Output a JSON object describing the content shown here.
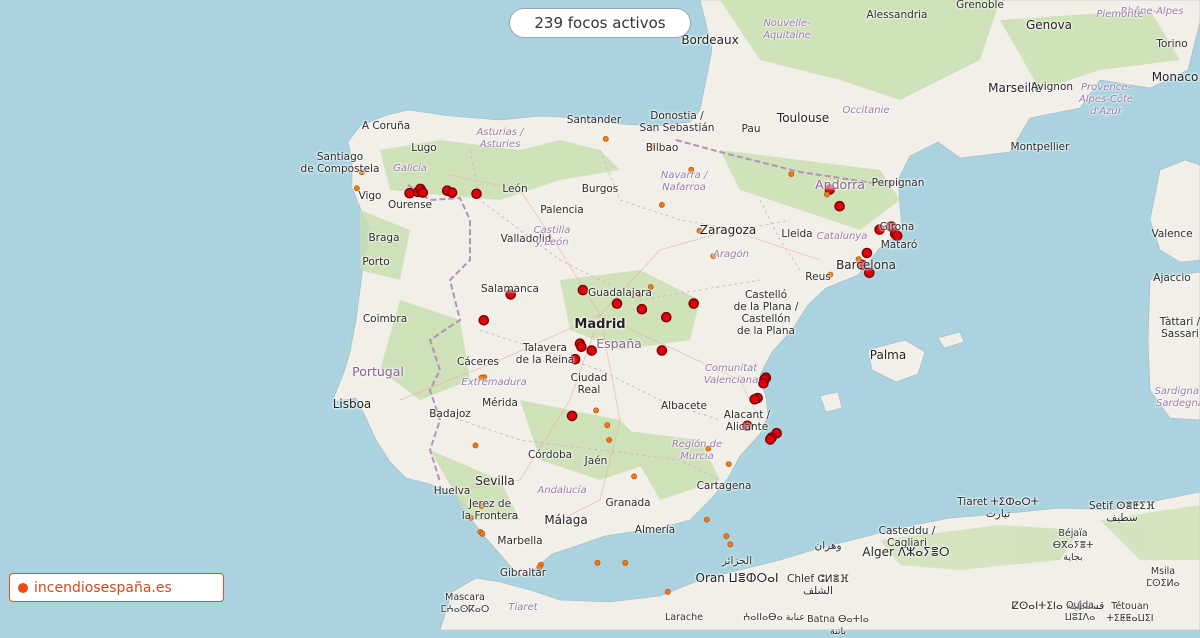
{
  "counter": {
    "text": "239 focos activos"
  },
  "brand": {
    "text": "incendiosespaña.es",
    "color": "#ef4a11"
  },
  "colors": {
    "sea": "#aad3df",
    "land": "#f2efe9",
    "forest": "#c9dfb1",
    "fire_large": "#e0000b",
    "fire_small": "#f07a16",
    "border": "#b292b8"
  },
  "labels": [
    {
      "text": "A Coruña",
      "kind": "city"
    },
    {
      "text": "Lugo",
      "kind": "city"
    },
    {
      "text": "Santiago\nde Compostela",
      "kind": "city"
    },
    {
      "text": "Galicia",
      "kind": "region"
    },
    {
      "text": "Vigo",
      "kind": "city"
    },
    {
      "text": "Ourense",
      "kind": "city"
    },
    {
      "text": "Braga",
      "kind": "city"
    },
    {
      "text": "Porto",
      "kind": "city"
    },
    {
      "text": "Coimbra",
      "kind": "city"
    },
    {
      "text": "Portugal",
      "kind": "country"
    },
    {
      "text": "Lisboa",
      "kind": "bigcity"
    },
    {
      "text": "Asturias /\nAsturies",
      "kind": "region"
    },
    {
      "text": "León",
      "kind": "city"
    },
    {
      "text": "Santander",
      "kind": "city"
    },
    {
      "text": "Bilbao",
      "kind": "city"
    },
    {
      "text": "Donostia /\nSan Sebastián",
      "kind": "city"
    },
    {
      "text": "Burgos",
      "kind": "city"
    },
    {
      "text": "Palencia",
      "kind": "city"
    },
    {
      "text": "Valladolid",
      "kind": "city"
    },
    {
      "text": "Castilla\ny León",
      "kind": "region"
    },
    {
      "text": "Navarra /\nNafarroa",
      "kind": "region"
    },
    {
      "text": "Zaragoza",
      "kind": "bigcity"
    },
    {
      "text": "Aragón",
      "kind": "region"
    },
    {
      "text": "Salamanca",
      "kind": "city"
    },
    {
      "text": "Guadalajara",
      "kind": "city"
    },
    {
      "text": "Madrid",
      "kind": "capital"
    },
    {
      "text": "España",
      "kind": "country"
    },
    {
      "text": "Talavera\nde la Reina",
      "kind": "city"
    },
    {
      "text": "Cáceres",
      "kind": "city"
    },
    {
      "text": "Extremadura",
      "kind": "region"
    },
    {
      "text": "Mérida",
      "kind": "city"
    },
    {
      "text": "Badajoz",
      "kind": "city"
    },
    {
      "text": "Ciudad\nReal",
      "kind": "city"
    },
    {
      "text": "Albacete",
      "kind": "city"
    },
    {
      "text": "Córdoba",
      "kind": "city"
    },
    {
      "text": "Jaén",
      "kind": "city"
    },
    {
      "text": "Sevilla",
      "kind": "bigcity"
    },
    {
      "text": "Andalucía",
      "kind": "region"
    },
    {
      "text": "Huelva",
      "kind": "city"
    },
    {
      "text": "Jerez de\nla Frontera",
      "kind": "city"
    },
    {
      "text": "Granada",
      "kind": "city"
    },
    {
      "text": "Málaga",
      "kind": "bigcity"
    },
    {
      "text": "Almería",
      "kind": "city"
    },
    {
      "text": "Marbella",
      "kind": "city"
    },
    {
      "text": "Gibraltar",
      "kind": "city"
    },
    {
      "text": "Región de\nMurcia",
      "kind": "region"
    },
    {
      "text": "Cartagena",
      "kind": "city"
    },
    {
      "text": "Alacant /\nAlicante",
      "kind": "city"
    },
    {
      "text": "Comunitat\nValenciana",
      "kind": "region"
    },
    {
      "text": "Castelló\nde la Plana /\nCastellón\nde la Plana",
      "kind": "city"
    },
    {
      "text": "Lleida",
      "kind": "city"
    },
    {
      "text": "Catalunya",
      "kind": "region"
    },
    {
      "text": "Reus",
      "kind": "city"
    },
    {
      "text": "Barcelona",
      "kind": "bigcity"
    },
    {
      "text": "Mataró",
      "kind": "city"
    },
    {
      "text": "Girona",
      "kind": "city"
    },
    {
      "text": "Andorra",
      "kind": "country"
    },
    {
      "text": "Perpignan",
      "kind": "city"
    },
    {
      "text": "Palma",
      "kind": "bigcity"
    },
    {
      "text": "Bordeaux",
      "kind": "bigcity"
    },
    {
      "text": "Nouvelle-\nAquitaine",
      "kind": "region"
    },
    {
      "text": "Pau",
      "kind": "city"
    },
    {
      "text": "Toulouse",
      "kind": "bigcity"
    },
    {
      "text": "Occitanie",
      "kind": "region"
    },
    {
      "text": "Montpellier",
      "kind": "city"
    },
    {
      "text": "Marseille",
      "kind": "bigcity"
    },
    {
      "text": "Avignon",
      "kind": "city"
    },
    {
      "text": "Provence-\nAlpes-Côte\nd'Azur",
      "kind": "region"
    },
    {
      "text": "Monaco",
      "kind": "bigcity"
    },
    {
      "text": "Genova",
      "kind": "bigcity"
    },
    {
      "text": "Grenoble",
      "kind": "city"
    },
    {
      "text": "Rhône-Alpes",
      "kind": "region"
    },
    {
      "text": "Piemonte",
      "kind": "region"
    },
    {
      "text": "Torino",
      "kind": "city"
    },
    {
      "text": "Alessandria",
      "kind": "city"
    },
    {
      "text": "Valence",
      "kind": "city"
    },
    {
      "text": "Ajaccio",
      "kind": "city"
    },
    {
      "text": "Tàttari /\nSassari",
      "kind": "city"
    },
    {
      "text": "Sardigna /\nSardegna",
      "kind": "region"
    },
    {
      "text": "Casteddu /\nCagliari",
      "kind": "city"
    },
    {
      "text": "Alger ⴷⵣⴰⵢⴻⵔ",
      "kind": "bigcity"
    },
    {
      "text": "الجزائر",
      "kind": "city"
    },
    {
      "text": "Oran ⵡⴻⵀⵔⴰⵏ",
      "kind": "bigcity"
    },
    {
      "text": "وهران",
      "kind": "city"
    },
    {
      "text": "Chlef ⵛⵍⴻⴼ\nالشلف",
      "kind": "city"
    },
    {
      "text": "Tiaret ⵜⵉⵀⴰⵔⵜ\nتيارت",
      "kind": "city"
    },
    {
      "text": "Béjaïa\nⴱⴳⴰⵢⴻⵜ\nبجاية",
      "kind": "small"
    },
    {
      "text": "Setif ⵙⴻⵟⵉⴼ\nسطيف",
      "kind": "city"
    },
    {
      "text": "ⵇⵙⴰⵏⵜⵉⵏⴰ قسنطينة",
      "kind": "city"
    },
    {
      "text": "ⵄⴰⵏⵏⴰⴱⴰ عنابة",
      "kind": "small"
    },
    {
      "text": "Batna ⴱⴰⵜⵏⴰ\nباتنة",
      "kind": "small"
    },
    {
      "text": "Mascara\nⵎⵄⴰⵙⴽⴰⵔ",
      "kind": "small"
    },
    {
      "text": "Tiaret",
      "kind": "region"
    },
    {
      "text": "Larache",
      "kind": "small"
    },
    {
      "text": "Tétouan\nⵜⵉⵟⵟⴰⵡⵉⵏ",
      "kind": "small"
    },
    {
      "text": "Oujda\nⵡⵓⵊⴷⴰ",
      "kind": "small"
    },
    {
      "text": "Msila\nⵎⵙⵉⵍⴰ",
      "kind": "small"
    },
    {
      "text": "Tébessa\nⵜⵉⴱⴻⵙⵜ",
      "kind": "small"
    },
    {
      "text": "Souk Ahras\nسوق أهراس",
      "kind": "small"
    }
  ],
  "fires": [
    {
      "lat": 42.54,
      "lon": -7.57,
      "size": "large"
    },
    {
      "lat": 42.56,
      "lon": -7.4,
      "size": "large"
    },
    {
      "lat": 42.61,
      "lon": -7.35,
      "size": "large"
    },
    {
      "lat": 42.55,
      "lon": -7.3,
      "size": "large"
    },
    {
      "lat": 42.58,
      "lon": -6.8,
      "size": "large"
    },
    {
      "lat": 42.55,
      "lon": -6.7,
      "size": "large"
    },
    {
      "lat": 42.53,
      "lon": -6.2,
      "size": "large"
    },
    {
      "lat": 42.6,
      "lon": 1.04,
      "size": "large"
    },
    {
      "lat": 42.33,
      "lon": 1.24,
      "size": "large"
    },
    {
      "lat": 41.95,
      "lon": 2.06,
      "size": "large"
    },
    {
      "lat": 42.0,
      "lon": 2.3,
      "size": "large"
    },
    {
      "lat": 41.88,
      "lon": 2.38,
      "size": "large"
    },
    {
      "lat": 41.85,
      "lon": 2.42,
      "size": "large"
    },
    {
      "lat": 41.57,
      "lon": 1.8,
      "size": "large"
    },
    {
      "lat": 41.38,
      "lon": 1.7,
      "size": "large"
    },
    {
      "lat": 41.25,
      "lon": 1.85,
      "size": "large"
    },
    {
      "lat": 40.9,
      "lon": -5.5,
      "size": "large"
    },
    {
      "lat": 40.97,
      "lon": -4.02,
      "size": "large"
    },
    {
      "lat": 40.75,
      "lon": -3.32,
      "size": "large"
    },
    {
      "lat": 40.66,
      "lon": -2.81,
      "size": "large"
    },
    {
      "lat": 40.53,
      "lon": -2.31,
      "size": "large"
    },
    {
      "lat": 40.75,
      "lon": -1.75,
      "size": "large"
    },
    {
      "lat": 40.48,
      "lon": -6.05,
      "size": "large"
    },
    {
      "lat": 40.1,
      "lon": -4.08,
      "size": "large"
    },
    {
      "lat": 40.05,
      "lon": -4.05,
      "size": "large"
    },
    {
      "lat": 39.99,
      "lon": -3.84,
      "size": "large"
    },
    {
      "lat": 39.99,
      "lon": -2.4,
      "size": "large"
    },
    {
      "lat": 39.85,
      "lon": -4.18,
      "size": "large"
    },
    {
      "lat": 39.55,
      "lon": -0.27,
      "size": "large"
    },
    {
      "lat": 39.52,
      "lon": -0.3,
      "size": "large"
    },
    {
      "lat": 39.46,
      "lon": -0.32,
      "size": "large"
    },
    {
      "lat": 39.22,
      "lon": -0.44,
      "size": "large"
    },
    {
      "lat": 39.2,
      "lon": -0.5,
      "size": "large"
    },
    {
      "lat": 38.93,
      "lon": -4.24,
      "size": "large"
    },
    {
      "lat": 38.77,
      "lon": -0.65,
      "size": "large"
    },
    {
      "lat": 38.65,
      "lon": -0.05,
      "size": "large"
    },
    {
      "lat": 38.58,
      "lon": -0.15,
      "size": "large"
    },
    {
      "lat": 38.55,
      "lon": -0.18,
      "size": "large"
    },
    {
      "lat": 43.42,
      "lon": -3.55,
      "size": "small"
    },
    {
      "lat": 43.3,
      "lon": -2.6,
      "size": "small"
    },
    {
      "lat": 42.92,
      "lon": -1.8,
      "size": "small"
    },
    {
      "lat": 42.62,
      "lon": -8.65,
      "size": "small"
    },
    {
      "lat": 42.88,
      "lon": -8.55,
      "size": "small"
    },
    {
      "lat": 42.35,
      "lon": -2.4,
      "size": "small"
    },
    {
      "lat": 42.85,
      "lon": 0.25,
      "size": "small"
    },
    {
      "lat": 42.52,
      "lon": 0.98,
      "size": "small"
    },
    {
      "lat": 41.93,
      "lon": -1.63,
      "size": "small"
    },
    {
      "lat": 41.52,
      "lon": -1.35,
      "size": "small"
    },
    {
      "lat": 41.47,
      "lon": 1.63,
      "size": "small"
    },
    {
      "lat": 41.22,
      "lon": 1.05,
      "size": "small"
    },
    {
      "lat": 41.02,
      "lon": -2.63,
      "size": "small"
    },
    {
      "lat": 40.9,
      "lon": -2.87,
      "size": "small"
    },
    {
      "lat": 39.56,
      "lon": -6.04,
      "size": "small"
    },
    {
      "lat": 39.55,
      "lon": -6.1,
      "size": "small"
    },
    {
      "lat": 39.02,
      "lon": -3.75,
      "size": "small"
    },
    {
      "lat": 38.78,
      "lon": -3.52,
      "size": "small"
    },
    {
      "lat": 38.54,
      "lon": -3.48,
      "size": "small"
    },
    {
      "lat": 38.45,
      "lon": -6.22,
      "size": "small"
    },
    {
      "lat": 38.4,
      "lon": -1.45,
      "size": "small"
    },
    {
      "lat": 38.15,
      "lon": -1.03,
      "size": "small"
    },
    {
      "lat": 37.95,
      "lon": -2.97,
      "size": "small"
    },
    {
      "lat": 37.47,
      "lon": -6.1,
      "size": "small"
    },
    {
      "lat": 37.28,
      "lon": -6.32,
      "size": "small"
    },
    {
      "lat": 37.05,
      "lon": -6.12,
      "size": "small"
    },
    {
      "lat": 37.02,
      "lon": -6.08,
      "size": "small"
    },
    {
      "lat": 37.25,
      "lon": -1.48,
      "size": "small"
    },
    {
      "lat": 36.98,
      "lon": -1.08,
      "size": "small"
    },
    {
      "lat": 36.85,
      "lon": -1.0,
      "size": "small"
    },
    {
      "lat": 36.52,
      "lon": -4.88,
      "size": "small"
    },
    {
      "lat": 36.48,
      "lon": -4.91,
      "size": "small"
    },
    {
      "lat": 36.55,
      "lon": -3.72,
      "size": "small"
    },
    {
      "lat": 36.08,
      "lon": -2.28,
      "size": "small"
    },
    {
      "lat": 36.55,
      "lon": -3.15,
      "size": "small"
    }
  ]
}
